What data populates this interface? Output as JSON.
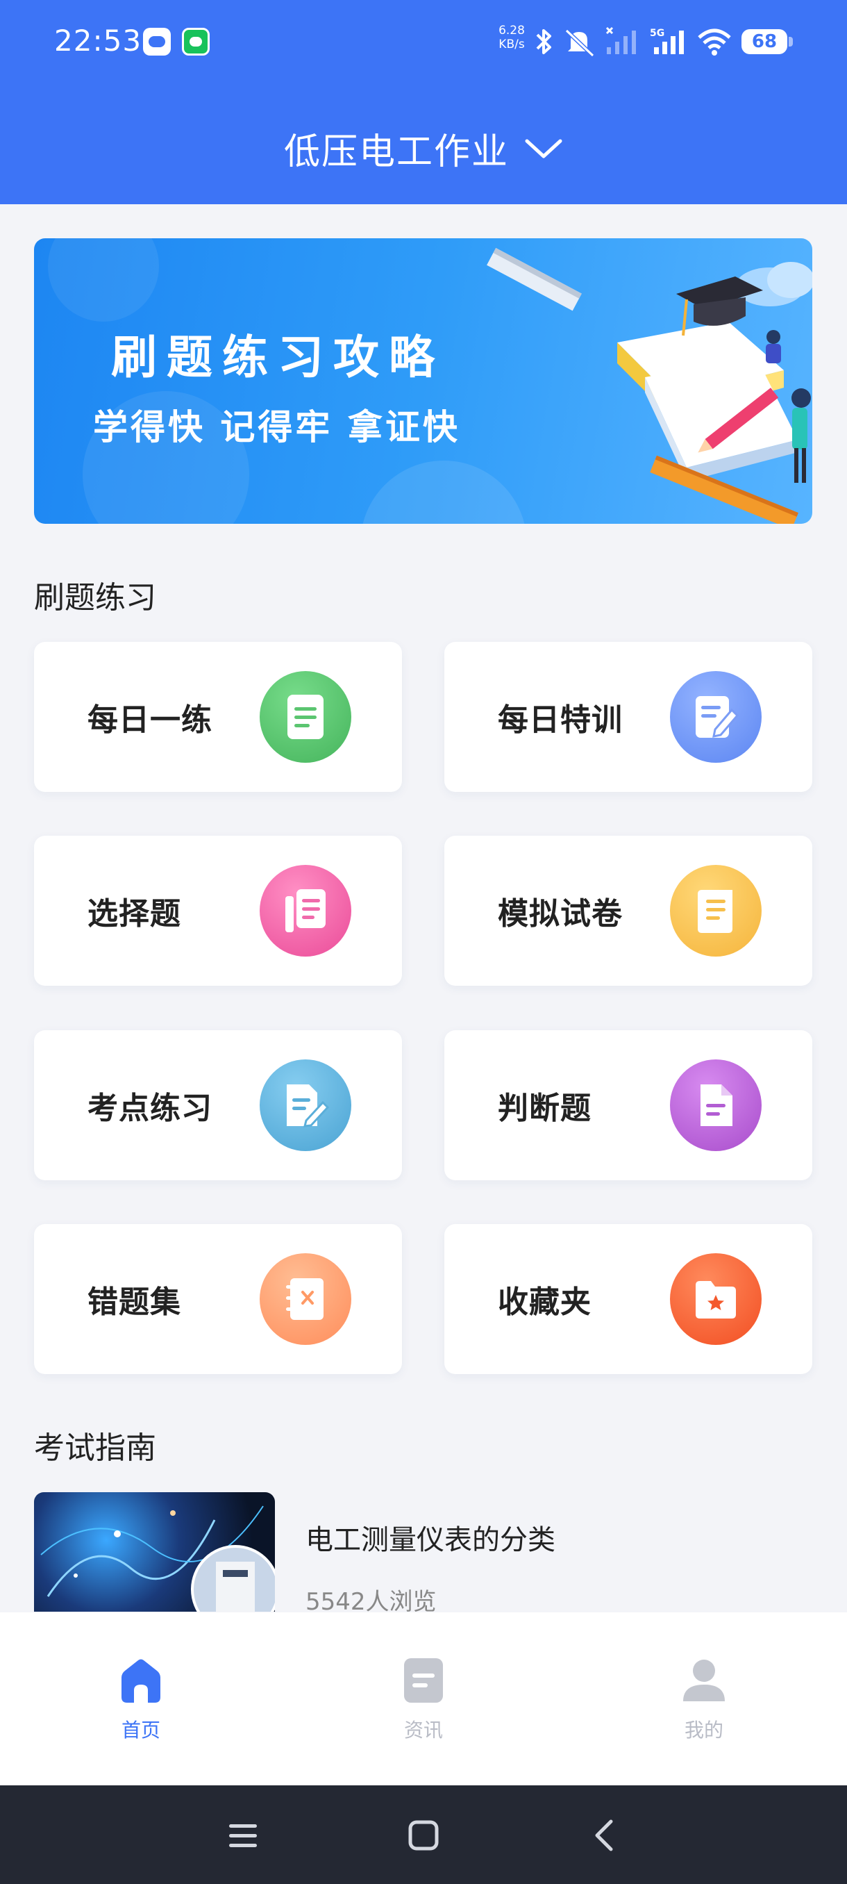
{
  "status_bar": {
    "time": "22:53",
    "net_speed_value": "6.28",
    "net_speed_unit": "KB/s",
    "network": "5G",
    "battery": "68"
  },
  "header": {
    "title": "低压电工作业",
    "dropdown_icon": "chevron-down-icon"
  },
  "banner": {
    "title": "刷题练习攻略",
    "subtitle": "学得快 记得牢 拿证快"
  },
  "practice": {
    "section_title": "刷题练习",
    "items": [
      {
        "label": "每日一练",
        "icon": "document-icon",
        "color": "#4fc56c"
      },
      {
        "label": "每日特训",
        "icon": "edit-document-icon",
        "color": "#6f97f7"
      },
      {
        "label": "选择题",
        "icon": "list-icon",
        "color": "#f25ea8"
      },
      {
        "label": "模拟试卷",
        "icon": "scroll-icon",
        "color": "#f9bf47"
      },
      {
        "label": "考点练习",
        "icon": "note-edit-icon",
        "color": "#57acd9"
      },
      {
        "label": "判断题",
        "icon": "file-icon",
        "color": "#b15ad2"
      },
      {
        "label": "错题集",
        "icon": "wrong-book-icon",
        "color": "#ff9d6b"
      },
      {
        "label": "收藏夹",
        "icon": "star-folder-icon",
        "color": "#ff5d35"
      }
    ]
  },
  "guide": {
    "section_title": "考试指南",
    "article_title": "电工测量仪表的分类",
    "article_views": "5542人浏览"
  },
  "tabbar": {
    "tabs": [
      {
        "label": "首页",
        "icon": "home-icon",
        "active": true
      },
      {
        "label": "资讯",
        "icon": "news-icon",
        "active": false
      },
      {
        "label": "我的",
        "icon": "user-icon",
        "active": false
      }
    ]
  },
  "system_nav": {
    "buttons": [
      "menu-icon",
      "home-square-icon",
      "back-icon"
    ]
  }
}
